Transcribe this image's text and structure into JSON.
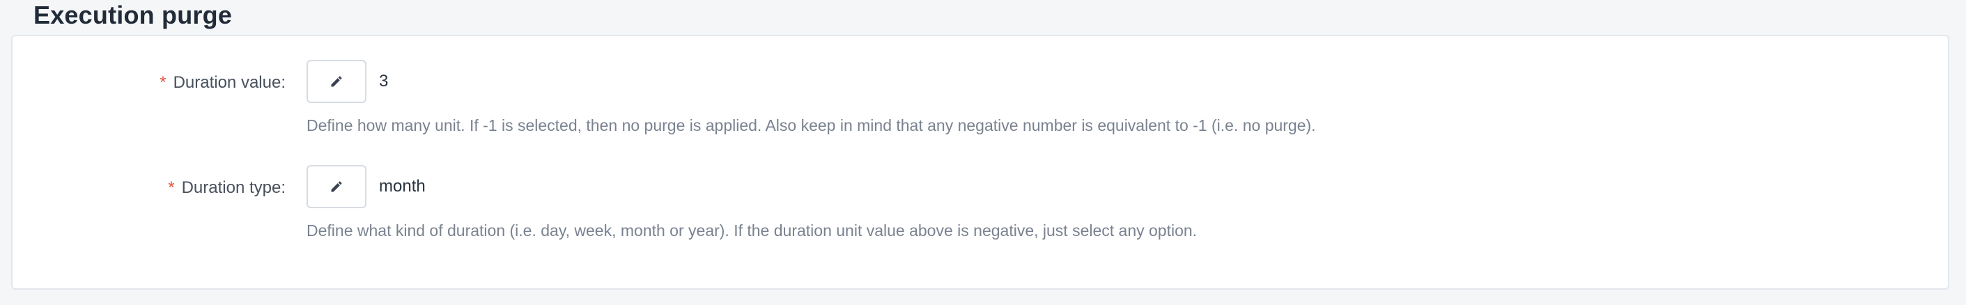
{
  "section": {
    "title": "Execution purge"
  },
  "fields": [
    {
      "required_marker": "*",
      "label": "Duration value:",
      "value": "3",
      "help": "Define how many unit. If -1 is selected, then no purge is applied. Also keep in mind that any negative number is equivalent to -1 (i.e. no purge).",
      "edit_icon": "pencil-icon"
    },
    {
      "required_marker": "*",
      "label": "Duration type:",
      "value": "month",
      "help": "Define what kind of duration (i.e. day, week, month or year). If the duration unit value above is negative, just select any option.",
      "edit_icon": "pencil-icon"
    }
  ],
  "colors": {
    "required": "#e5533d",
    "help_text": "#7a8290",
    "panel_border": "#e3e7ec",
    "page_background": "#f4f6f8"
  }
}
